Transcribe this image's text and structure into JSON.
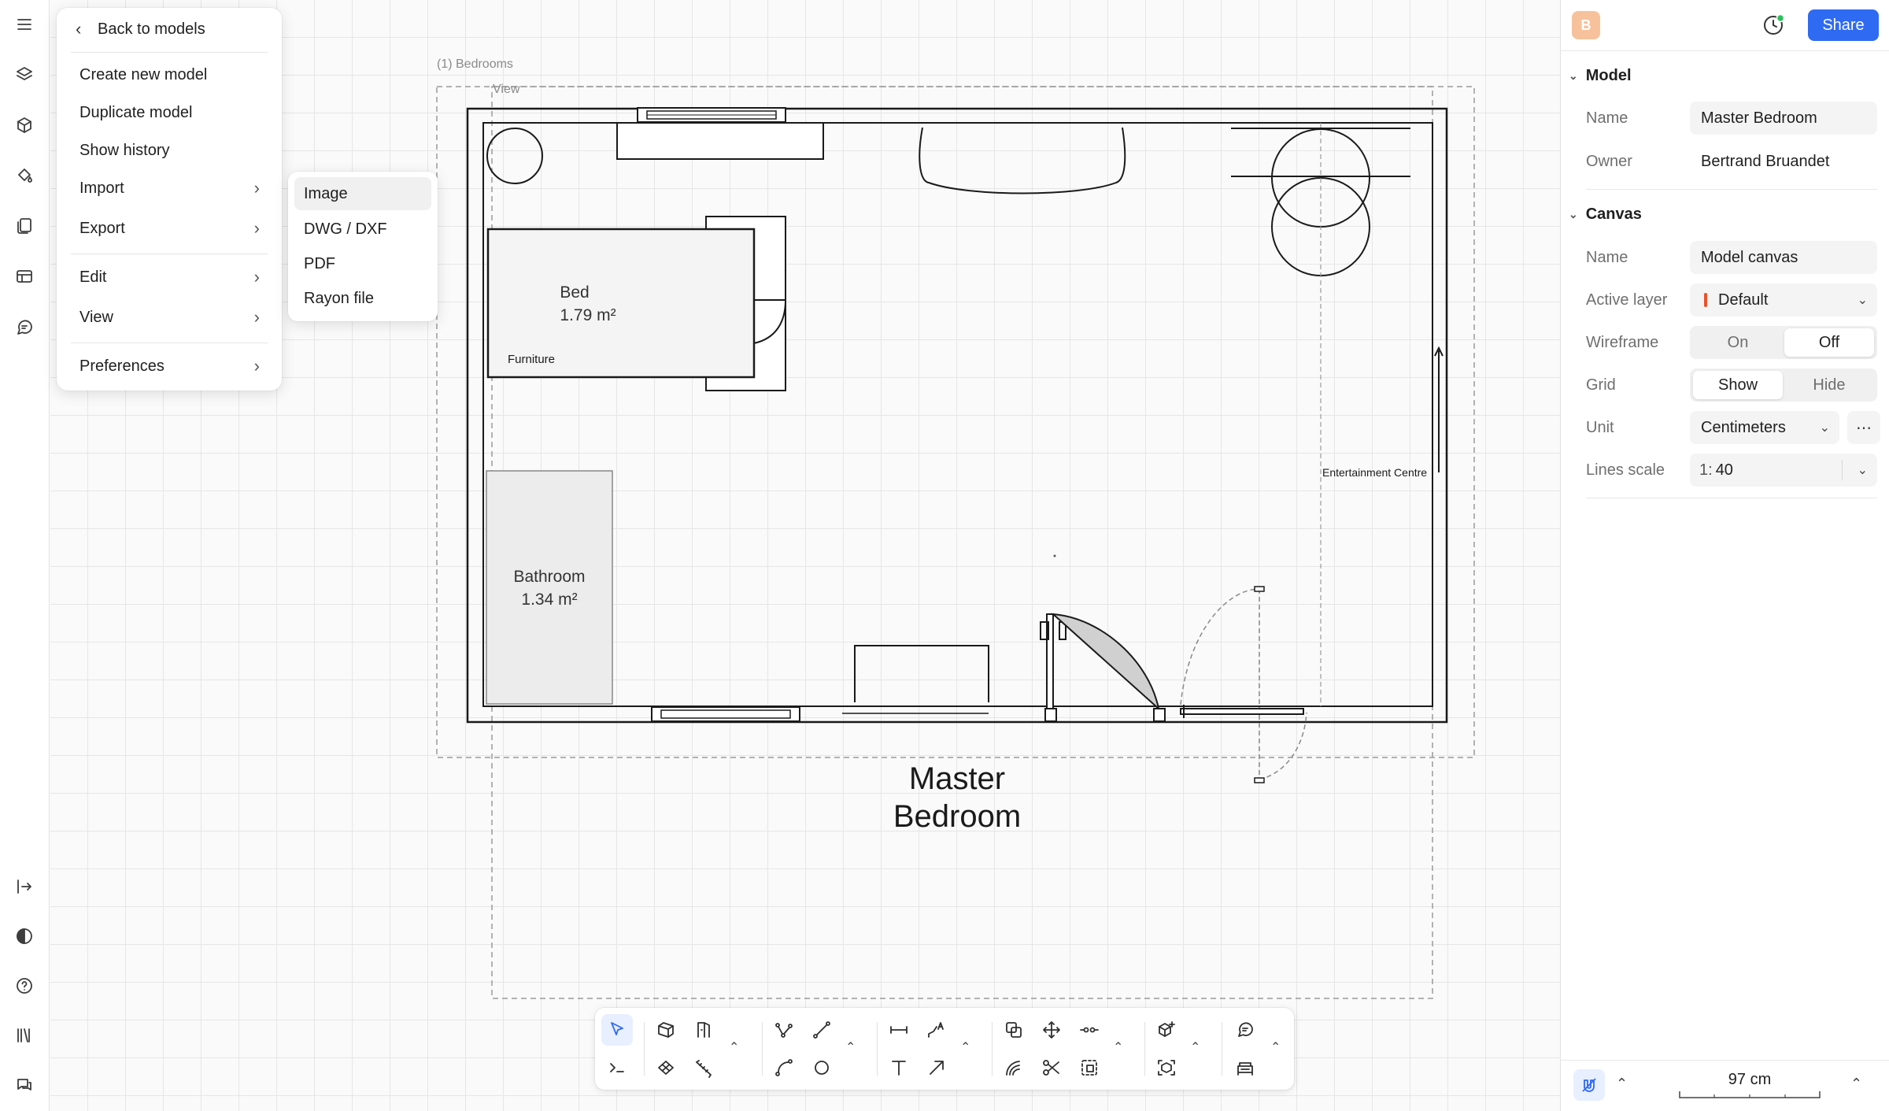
{
  "main_menu": {
    "back_label": "Back to models",
    "items": [
      {
        "label": "Create new model"
      },
      {
        "label": "Duplicate model"
      },
      {
        "label": "Show history"
      },
      {
        "label": "Import"
      },
      {
        "label": "Export"
      },
      {
        "label": "Edit"
      },
      {
        "label": "View"
      },
      {
        "label": "Preferences"
      }
    ]
  },
  "import_submenu": {
    "items": [
      {
        "label": "Image",
        "active": true
      },
      {
        "label": "DWG / DXF"
      },
      {
        "label": "PDF"
      },
      {
        "label": "Rayon file"
      }
    ]
  },
  "header": {
    "avatar_letter": "B",
    "share_label": "Share"
  },
  "model_section": {
    "title": "Model",
    "name_label": "Name",
    "name_value": "Master Bedroom",
    "owner_label": "Owner",
    "owner_value": "Bertrand Bruandet"
  },
  "canvas_section": {
    "title": "Canvas",
    "name_label": "Name",
    "name_value": "Model canvas",
    "active_layer_label": "Active layer",
    "active_layer_value": "Default",
    "active_layer_color": "#e8542c",
    "wireframe_label": "Wireframe",
    "wireframe_on": "On",
    "wireframe_off": "Off",
    "wireframe_selected": "Off",
    "grid_label": "Grid",
    "grid_show": "Show",
    "grid_hide": "Hide",
    "grid_selected": "Show",
    "unit_label": "Unit",
    "unit_value": "Centimeters",
    "lines_scale_label": "Lines scale",
    "lines_scale_prefix": "1:",
    "lines_scale_value": "40"
  },
  "footer": {
    "scale_readout": "97 cm"
  },
  "plan": {
    "group_label": "(1) Bedrooms",
    "view_label": "View",
    "room_title_line1": "Master",
    "room_title_line2": "Bedroom",
    "bed_label": "Bed",
    "bed_area": "1.79 m²",
    "furniture_label": "Furniture",
    "bathroom_label": "Bathroom",
    "bathroom_area": "1.34 m²",
    "entertainment_label": "Entertainment Centre"
  },
  "colors": {
    "accent": "#2f6af2",
    "avatar": "#f7c29b",
    "online_dot": "#2bbf5a"
  }
}
